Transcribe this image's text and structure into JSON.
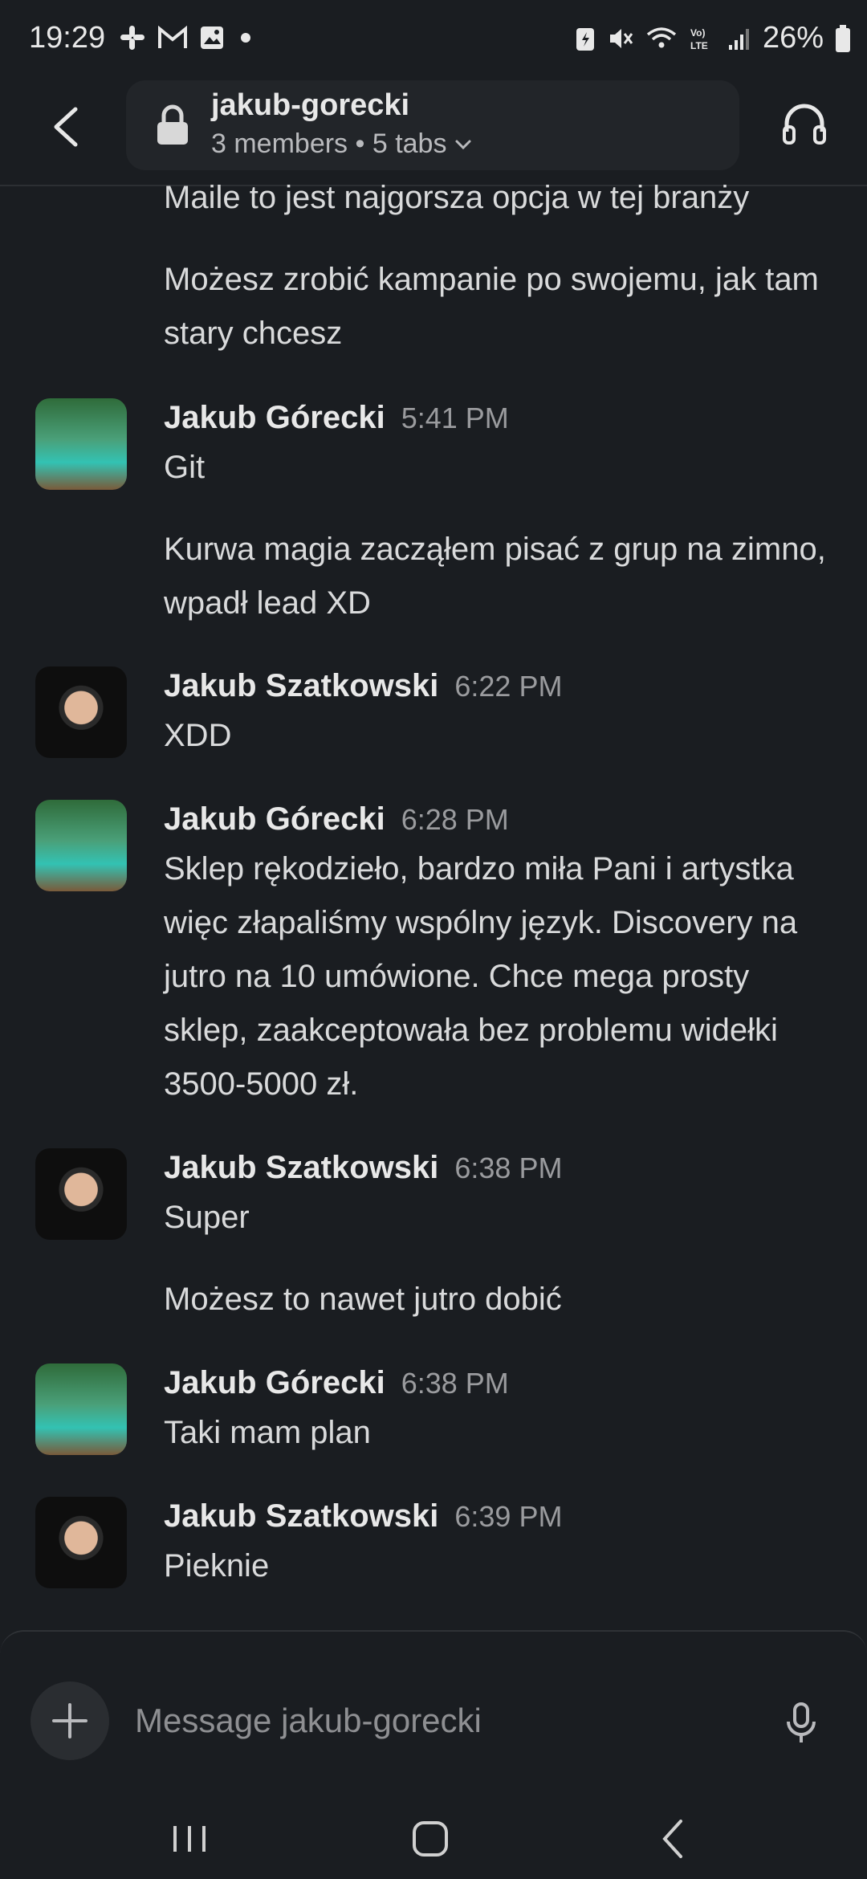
{
  "status": {
    "time": "19:29",
    "battery": "26%"
  },
  "header": {
    "channel": "jakub-gorecki",
    "meta": "3 members • 5 tabs"
  },
  "messages": {
    "m0": "Maile to jest najgorsza opcja w tej branży",
    "m1": "Możesz zrobić kampanie po swojemu, jak tam stary chcesz",
    "g1": {
      "author": "Jakub Górecki",
      "time": "5:41 PM",
      "lines": [
        "Git",
        "Kurwa magia zacząłem pisać z grup na zimno, wpadł lead XD"
      ]
    },
    "s1": {
      "author": "Jakub Szatkowski",
      "time": "6:22 PM",
      "lines": [
        "XDD"
      ]
    },
    "g2": {
      "author": "Jakub Górecki",
      "time": "6:28 PM",
      "lines": [
        "Sklep rękodzieło, bardzo miła Pani i artystka więc złapaliśmy wspólny język. Discovery na jutro na 10 umówione. Chce mega prosty sklep, zaakceptowała bez problemu widełki 3500-5000 zł."
      ]
    },
    "s2": {
      "author": "Jakub Szatkowski",
      "time": "6:38 PM",
      "lines": [
        "Super",
        "Możesz to nawet jutro dobić"
      ]
    },
    "g3": {
      "author": "Jakub Górecki",
      "time": "6:38 PM",
      "lines": [
        "Taki mam plan"
      ]
    },
    "s3": {
      "author": "Jakub Szatkowski",
      "time": "6:39 PM",
      "lines": [
        "Pieknie"
      ]
    }
  },
  "composer": {
    "placeholder": "Message jakub-gorecki"
  }
}
